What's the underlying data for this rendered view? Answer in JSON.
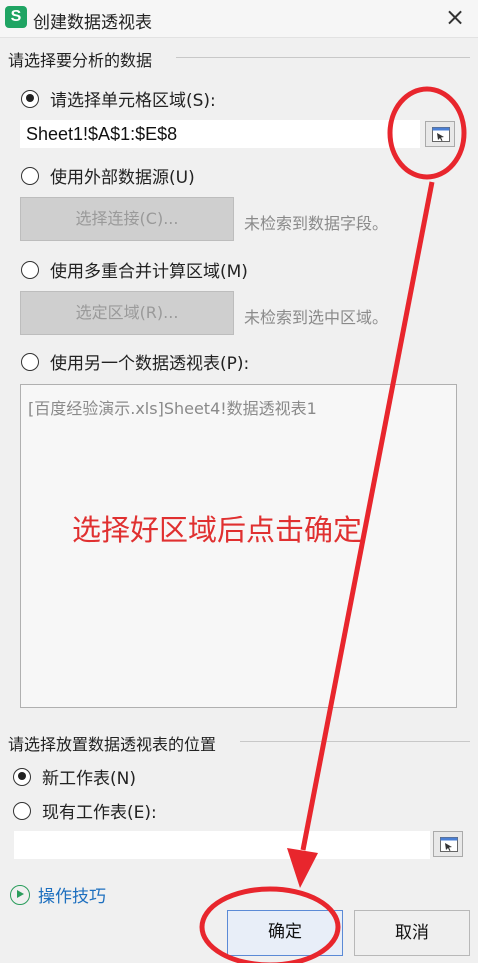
{
  "window": {
    "app_icon_letter": "S",
    "title": "创建数据透视表",
    "close_glyph": "×"
  },
  "source_group": {
    "label": "请选择要分析的数据",
    "option_range": {
      "label": "请选择单元格区域(S):",
      "checked": true
    },
    "range_value": "Sheet1!$A$1:$E$8",
    "option_external": {
      "label": "使用外部数据源(U)",
      "checked": false
    },
    "select_connection_button": "选择连接(C)...",
    "external_hint": "未检索到数据字段。",
    "option_multi": {
      "label": "使用多重合并计算区域(M)",
      "checked": false
    },
    "select_region_button": "选定区域(R)...",
    "multi_hint": "未检索到选中区域。",
    "option_pivot": {
      "label": "使用另一个数据透视表(P):",
      "checked": false
    },
    "pivot_list_item": "[百度经验演示.xls]Sheet4!数据透视表1"
  },
  "annotation_text": "选择好区域后点击确定",
  "placement_group": {
    "label": "请选择放置数据透视表的位置",
    "option_new_sheet": {
      "label": "新工作表(N)",
      "checked": true
    },
    "option_existing_sheet": {
      "label": "现有工作表(E):",
      "checked": false
    },
    "placement_value": ""
  },
  "tips_link": "操作技巧",
  "buttons": {
    "ok": "确定",
    "cancel": "取消"
  },
  "colors": {
    "brand_green": "#1fa463",
    "annotation_red": "#e03030",
    "link_blue": "#1d6fbf"
  }
}
